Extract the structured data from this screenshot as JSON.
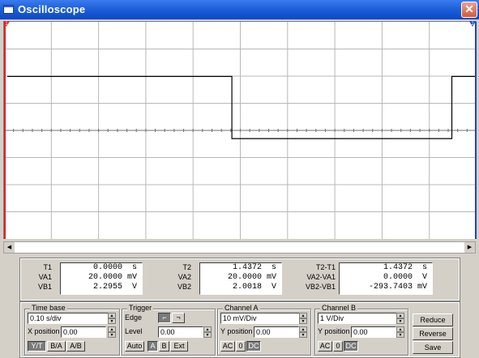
{
  "window": {
    "title": "Oscilloscope",
    "close_glyph": "✕"
  },
  "cursors": {
    "t1_label": "1",
    "t2_label": "2",
    "t1_color": "#e02020",
    "t2_color": "#2040d0"
  },
  "screen": {
    "grid_color": "#b8b8b8",
    "center_color": "#707070",
    "trace_color": "#000000",
    "trace": [
      [
        0.0,
        5.3
      ],
      [
        0.04,
        5.3
      ],
      [
        0.05,
        5.3
      ],
      [
        0.49,
        5.3
      ],
      [
        0.49,
        -0.8
      ],
      [
        0.5,
        -0.8
      ],
      [
        0.97,
        -0.8
      ],
      [
        0.97,
        5.3
      ],
      [
        0.98,
        5.3
      ],
      [
        1.43,
        5.3
      ]
    ]
  },
  "readout": {
    "t1": {
      "labels": [
        "T1",
        "VA1",
        "VB1"
      ],
      "values": [
        "0.0000",
        "20.0000",
        "2.2955"
      ],
      "units": [
        "s",
        "mV",
        "V"
      ]
    },
    "t2": {
      "labels": [
        "T2",
        "VA2",
        "VB2"
      ],
      "values": [
        "1.4372",
        "20.0000",
        "2.0018"
      ],
      "units": [
        "s",
        "mV",
        "V"
      ]
    },
    "diff": {
      "labels": [
        "T2-T1",
        "VA2-VA1",
        "VB2-VB1"
      ],
      "values": [
        "1.4372",
        "0.0000",
        "-293.7403"
      ],
      "units": [
        "s",
        "V",
        "mV"
      ]
    }
  },
  "timebase": {
    "title": "Time base",
    "scale": "0.10 s/div",
    "xpos_label": "X position",
    "xpos": "0.00",
    "modes": [
      "Y/T",
      "B/A",
      "A/B"
    ]
  },
  "trigger": {
    "title": "Trigger",
    "edge_label": "Edge",
    "level_label": "Level",
    "level": "0.00",
    "buttons": [
      "Auto",
      "A",
      "B",
      "Ext"
    ]
  },
  "channel_a": {
    "title": "Channel A",
    "scale": "10 mV/Div",
    "ypos_label": "Y position",
    "ypos": "0.00",
    "coupling": [
      "AC",
      "0",
      "DC"
    ]
  },
  "channel_b": {
    "title": "Channel B",
    "scale": "1 V/Div",
    "ypos_label": "Y position",
    "ypos": "0.00",
    "coupling": [
      "AC",
      "0",
      "DC"
    ]
  },
  "actions": {
    "reduce": "Reduce",
    "reverse": "Reverse",
    "save": "Save"
  }
}
